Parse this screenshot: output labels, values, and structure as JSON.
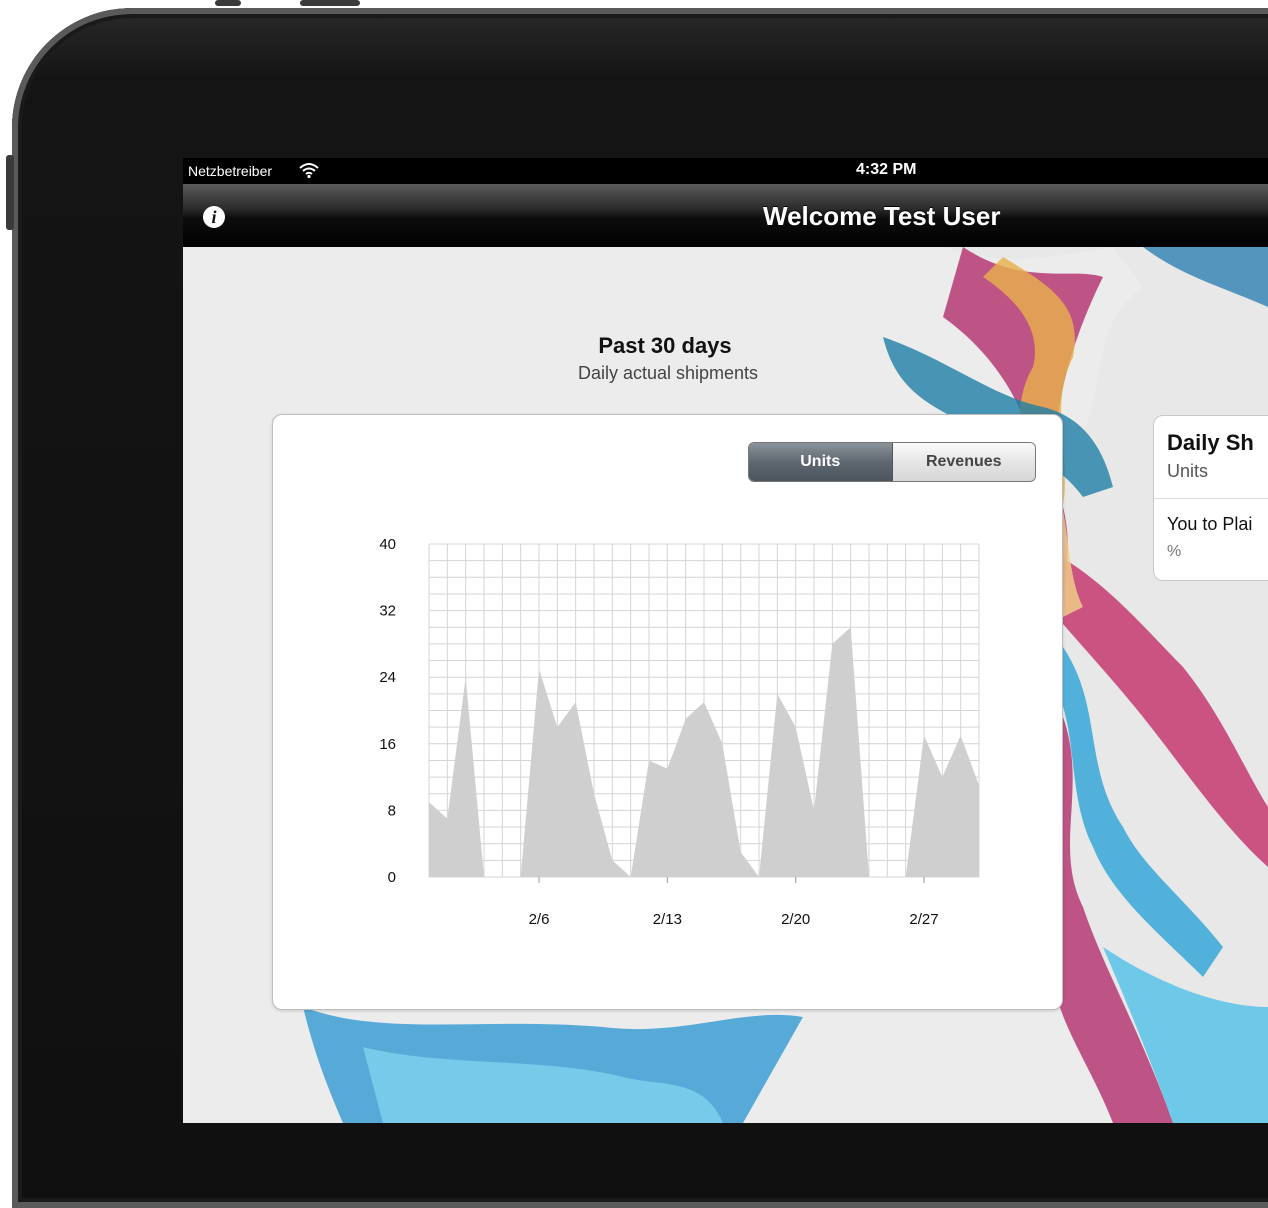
{
  "status_bar": {
    "carrier": "Netzbetreiber",
    "wifi_icon": "wifi-icon",
    "time": "4:32 PM"
  },
  "nav_bar": {
    "info_icon": "info-icon",
    "info_glyph": "i",
    "title": "Welcome Test User"
  },
  "main": {
    "heading": "Past 30 days",
    "subheading": "Daily actual shipments",
    "toggle": {
      "options": [
        "Units",
        "Revenues"
      ],
      "selected": "Units"
    }
  },
  "side_card": {
    "title": "Daily Sh",
    "unit": "Units",
    "metric": "You to Plai",
    "metric_unit": "%"
  },
  "colors": {
    "area_fill": "#cfcfcf",
    "grid": "#d4d4d4",
    "selected_segment": "#5f6770"
  },
  "chart_data": {
    "type": "area",
    "x_ticks": [
      "2/6",
      "2/13",
      "2/20",
      "2/27"
    ],
    "y_ticks": [
      0,
      8,
      16,
      24,
      32,
      40
    ],
    "ylim": [
      0,
      40
    ],
    "x": [
      "1/31",
      "2/1",
      "2/2",
      "2/3",
      "2/4",
      "2/5",
      "2/6",
      "2/7",
      "2/8",
      "2/9",
      "2/10",
      "2/11",
      "2/12",
      "2/13",
      "2/14",
      "2/15",
      "2/16",
      "2/17",
      "2/18",
      "2/19",
      "2/20",
      "2/21",
      "2/22",
      "2/23",
      "2/24",
      "2/25",
      "2/26",
      "2/27",
      "2/28",
      "2/29",
      "3/1"
    ],
    "values": [
      9,
      7,
      24,
      0,
      null,
      0,
      25,
      18,
      21,
      10,
      2,
      0,
      14,
      13,
      19,
      21,
      16,
      3,
      0,
      22,
      18,
      8,
      28,
      30,
      0,
      null,
      0,
      17,
      12,
      17,
      11
    ],
    "grid": true
  }
}
